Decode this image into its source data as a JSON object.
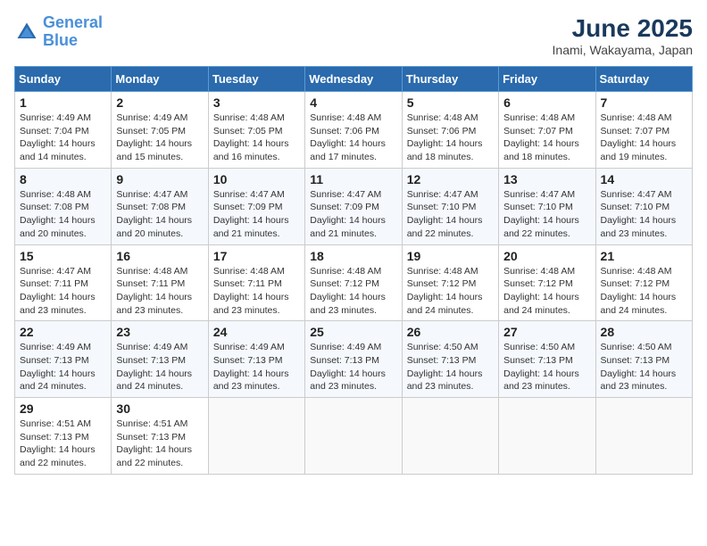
{
  "logo": {
    "text_general": "General",
    "text_blue": "Blue"
  },
  "title": "June 2025",
  "subtitle": "Inami, Wakayama, Japan",
  "header": {
    "days": [
      "Sunday",
      "Monday",
      "Tuesday",
      "Wednesday",
      "Thursday",
      "Friday",
      "Saturday"
    ]
  },
  "weeks": [
    {
      "days": [
        {
          "num": "1",
          "sunrise": "4:49 AM",
          "sunset": "7:04 PM",
          "daylight": "14 hours and 14 minutes."
        },
        {
          "num": "2",
          "sunrise": "4:49 AM",
          "sunset": "7:05 PM",
          "daylight": "14 hours and 15 minutes."
        },
        {
          "num": "3",
          "sunrise": "4:48 AM",
          "sunset": "7:05 PM",
          "daylight": "14 hours and 16 minutes."
        },
        {
          "num": "4",
          "sunrise": "4:48 AM",
          "sunset": "7:06 PM",
          "daylight": "14 hours and 17 minutes."
        },
        {
          "num": "5",
          "sunrise": "4:48 AM",
          "sunset": "7:06 PM",
          "daylight": "14 hours and 18 minutes."
        },
        {
          "num": "6",
          "sunrise": "4:48 AM",
          "sunset": "7:07 PM",
          "daylight": "14 hours and 18 minutes."
        },
        {
          "num": "7",
          "sunrise": "4:48 AM",
          "sunset": "7:07 PM",
          "daylight": "14 hours and 19 minutes."
        }
      ]
    },
    {
      "days": [
        {
          "num": "8",
          "sunrise": "4:48 AM",
          "sunset": "7:08 PM",
          "daylight": "14 hours and 20 minutes."
        },
        {
          "num": "9",
          "sunrise": "4:47 AM",
          "sunset": "7:08 PM",
          "daylight": "14 hours and 20 minutes."
        },
        {
          "num": "10",
          "sunrise": "4:47 AM",
          "sunset": "7:09 PM",
          "daylight": "14 hours and 21 minutes."
        },
        {
          "num": "11",
          "sunrise": "4:47 AM",
          "sunset": "7:09 PM",
          "daylight": "14 hours and 21 minutes."
        },
        {
          "num": "12",
          "sunrise": "4:47 AM",
          "sunset": "7:10 PM",
          "daylight": "14 hours and 22 minutes."
        },
        {
          "num": "13",
          "sunrise": "4:47 AM",
          "sunset": "7:10 PM",
          "daylight": "14 hours and 22 minutes."
        },
        {
          "num": "14",
          "sunrise": "4:47 AM",
          "sunset": "7:10 PM",
          "daylight": "14 hours and 23 minutes."
        }
      ]
    },
    {
      "days": [
        {
          "num": "15",
          "sunrise": "4:47 AM",
          "sunset": "7:11 PM",
          "daylight": "14 hours and 23 minutes."
        },
        {
          "num": "16",
          "sunrise": "4:48 AM",
          "sunset": "7:11 PM",
          "daylight": "14 hours and 23 minutes."
        },
        {
          "num": "17",
          "sunrise": "4:48 AM",
          "sunset": "7:11 PM",
          "daylight": "14 hours and 23 minutes."
        },
        {
          "num": "18",
          "sunrise": "4:48 AM",
          "sunset": "7:12 PM",
          "daylight": "14 hours and 23 minutes."
        },
        {
          "num": "19",
          "sunrise": "4:48 AM",
          "sunset": "7:12 PM",
          "daylight": "14 hours and 24 minutes."
        },
        {
          "num": "20",
          "sunrise": "4:48 AM",
          "sunset": "7:12 PM",
          "daylight": "14 hours and 24 minutes."
        },
        {
          "num": "21",
          "sunrise": "4:48 AM",
          "sunset": "7:12 PM",
          "daylight": "14 hours and 24 minutes."
        }
      ]
    },
    {
      "days": [
        {
          "num": "22",
          "sunrise": "4:49 AM",
          "sunset": "7:13 PM",
          "daylight": "14 hours and 24 minutes."
        },
        {
          "num": "23",
          "sunrise": "4:49 AM",
          "sunset": "7:13 PM",
          "daylight": "14 hours and 24 minutes."
        },
        {
          "num": "24",
          "sunrise": "4:49 AM",
          "sunset": "7:13 PM",
          "daylight": "14 hours and 23 minutes."
        },
        {
          "num": "25",
          "sunrise": "4:49 AM",
          "sunset": "7:13 PM",
          "daylight": "14 hours and 23 minutes."
        },
        {
          "num": "26",
          "sunrise": "4:50 AM",
          "sunset": "7:13 PM",
          "daylight": "14 hours and 23 minutes."
        },
        {
          "num": "27",
          "sunrise": "4:50 AM",
          "sunset": "7:13 PM",
          "daylight": "14 hours and 23 minutes."
        },
        {
          "num": "28",
          "sunrise": "4:50 AM",
          "sunset": "7:13 PM",
          "daylight": "14 hours and 23 minutes."
        }
      ]
    },
    {
      "days": [
        {
          "num": "29",
          "sunrise": "4:51 AM",
          "sunset": "7:13 PM",
          "daylight": "14 hours and 22 minutes."
        },
        {
          "num": "30",
          "sunrise": "4:51 AM",
          "sunset": "7:13 PM",
          "daylight": "14 hours and 22 minutes."
        },
        null,
        null,
        null,
        null,
        null
      ]
    }
  ],
  "labels": {
    "sunrise": "Sunrise:",
    "sunset": "Sunset:",
    "daylight": "Daylight:"
  }
}
